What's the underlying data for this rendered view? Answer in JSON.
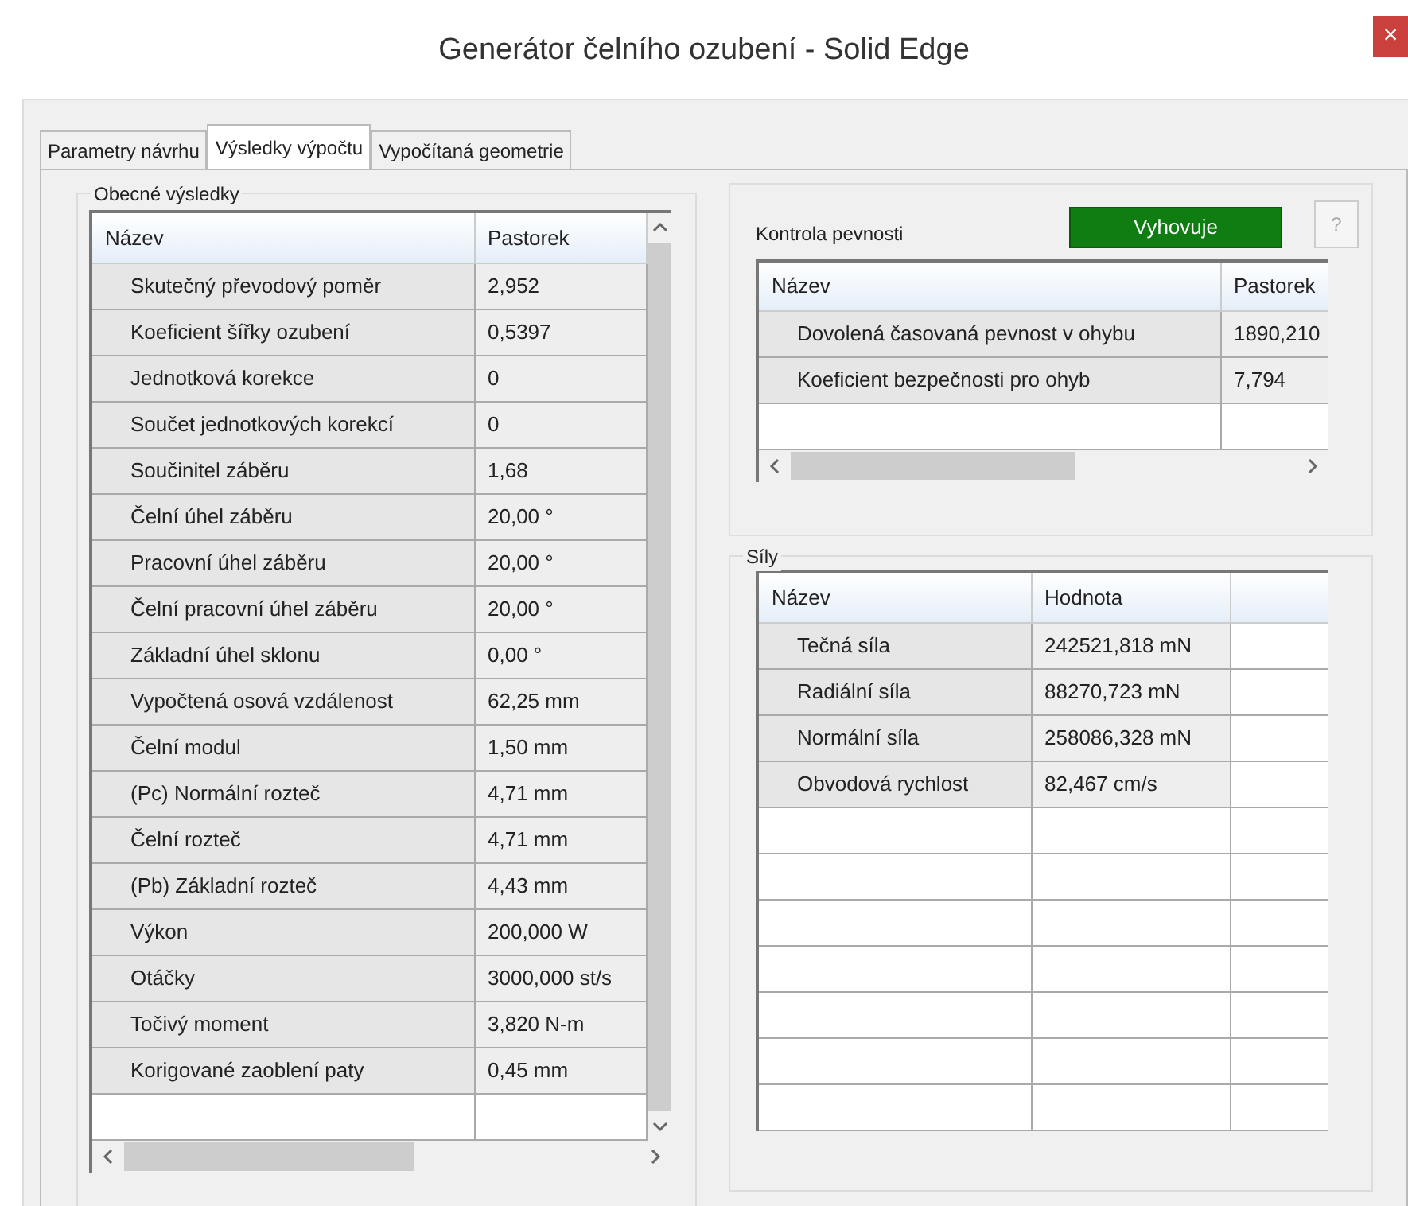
{
  "window": {
    "title": "Generátor čelního ozubení - Solid Edge",
    "close": "×"
  },
  "tabs": [
    {
      "label": "Parametry návrhu",
      "selected": false
    },
    {
      "label": "Výsledky výpočtu",
      "selected": true
    },
    {
      "label": "Vypočítaná geometrie",
      "selected": false
    }
  ],
  "general_results": {
    "title": "Obecné výsledky",
    "columns": [
      "Název",
      "Pastorek"
    ],
    "rows": [
      {
        "name": "Skutečný převodový poměr",
        "value": "2,952"
      },
      {
        "name": "Koeficient šířky ozubení",
        "value": "0,5397"
      },
      {
        "name": "Jednotková korekce",
        "value": "0"
      },
      {
        "name": "Součet jednotkových korekcí",
        "value": "0"
      },
      {
        "name": "Součinitel záběru",
        "value": "1,68"
      },
      {
        "name": "Čelní úhel záběru",
        "value": "20,00 °"
      },
      {
        "name": "Pracovní úhel záběru",
        "value": "20,00 °"
      },
      {
        "name": "Čelní pracovní úhel záběru",
        "value": "20,00 °"
      },
      {
        "name": "Základní úhel sklonu",
        "value": "0,00 °"
      },
      {
        "name": "Vypočtená osová vzdálenost",
        "value": "62,25 mm"
      },
      {
        "name": "Čelní modul",
        "value": "1,50 mm"
      },
      {
        "name": "(Pc) Normální rozteč",
        "value": "4,71 mm"
      },
      {
        "name": "Čelní rozteč",
        "value": "4,71 mm"
      },
      {
        "name": "(Pb) Základní rozteč",
        "value": "4,43 mm"
      },
      {
        "name": "Výkon",
        "value": "200,000 W"
      },
      {
        "name": "Otáčky",
        "value": "3000,000 st/s"
      },
      {
        "name": "Točivý moment",
        "value": "3,820 N-m"
      },
      {
        "name": "Korigované zaoblení paty",
        "value": "0,45 mm"
      }
    ]
  },
  "strength_check": {
    "title": "Kontrola pevnosti",
    "status_button": "Vyhovuje",
    "help_button": {
      "label": "?",
      "disabled": true
    },
    "columns": [
      "Název",
      "Pastorek"
    ],
    "rows": [
      {
        "name": "Dovolená časovaná pevnost v ohybu",
        "value": "1890,210"
      },
      {
        "name": "Koeficient bezpečnosti pro ohyb",
        "value": "7,794"
      }
    ]
  },
  "forces": {
    "title": "Síly",
    "columns": [
      "Název",
      "Hodnota"
    ],
    "rows": [
      {
        "name": "Tečná síla",
        "value": "242521,818 mN"
      },
      {
        "name": "Radiální síla",
        "value": "88270,723 mN"
      },
      {
        "name": "Normální síla",
        "value": "258086,328 mN"
      },
      {
        "name": "Obvodová rychlost",
        "value": "82,467 cm/s"
      }
    ]
  }
}
